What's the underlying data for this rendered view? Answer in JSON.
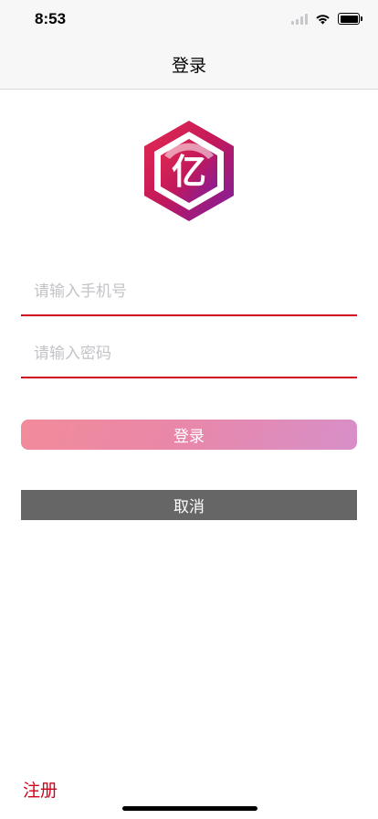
{
  "status_bar": {
    "time": "8:53",
    "icons": [
      "signal-icon",
      "wifi-icon",
      "battery-icon"
    ]
  },
  "nav": {
    "title": "登录"
  },
  "logo": {
    "text": "亿",
    "colors": [
      "#d0103a",
      "#7a1fa2",
      "#e52b50"
    ]
  },
  "form": {
    "phone_placeholder": "请输入手机号",
    "phone_value": "",
    "password_placeholder": "请输入密码",
    "password_value": "",
    "underline_color": "#d0021b"
  },
  "buttons": {
    "login_label": "登录",
    "cancel_label": "取消",
    "login_gradient": [
      "#f28b9a",
      "#d78fc8"
    ],
    "cancel_color": "#666666"
  },
  "footer": {
    "register_label": "注册",
    "register_color": "#d0021b"
  }
}
